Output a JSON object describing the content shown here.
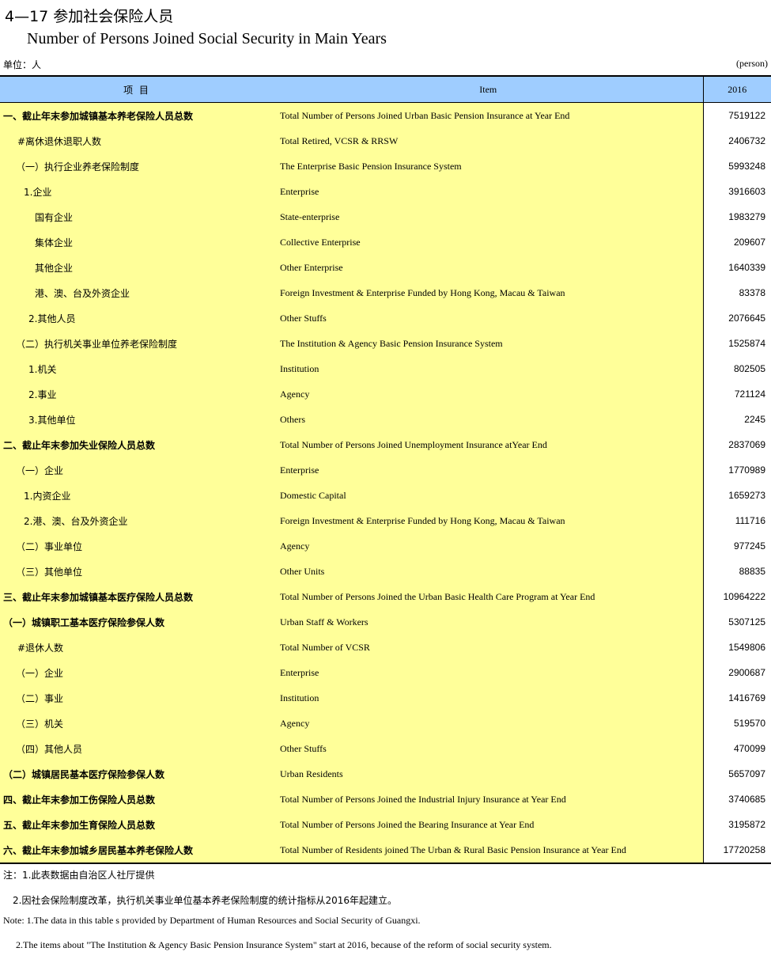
{
  "title": {
    "cn": "4—17  参加社会保险人员",
    "en": "Number of Persons Joined Social Security in Main Years"
  },
  "unit": {
    "cn": "单位：人",
    "en": "(person)"
  },
  "table": {
    "headers": {
      "item_cn": "项    目",
      "item_en": "Item",
      "year": "2016"
    },
    "rows": [
      {
        "cn": "一、截止年末参加城镇基本养老保险人员总数",
        "en": "Total Number of Persons Joined Urban Basic Pension Insurance at Year End",
        "value": "7519122",
        "bold": true,
        "indent": 0
      },
      {
        "cn": "#离休退休退职人数",
        "en": "Total Retired, VCSR & RRSW",
        "value": "2406732",
        "bold": false,
        "indent": 2
      },
      {
        "cn": "（一）执行企业养老保险制度",
        "en": "The Enterprise Basic Pension Insurance System",
        "value": "5993248",
        "bold": false,
        "indent": 1
      },
      {
        "cn": "1.企业",
        "en": "Enterprise",
        "value": "3916603",
        "bold": false,
        "indent": 3
      },
      {
        "cn": "国有企业",
        "en": "State-enterprise",
        "value": "1983279",
        "bold": false,
        "indent": 4
      },
      {
        "cn": "集体企业",
        "en": "Collective Enterprise",
        "value": "209607",
        "bold": false,
        "indent": 4
      },
      {
        "cn": "其他企业",
        "en": "Other Enterprise",
        "value": "1640339",
        "bold": false,
        "indent": 4
      },
      {
        "cn": "港、澳、台及外资企业",
        "en": "Foreign Investment & Enterprise Funded by Hong Kong, Macau & Taiwan",
        "value": "83378",
        "bold": false,
        "indent": 4
      },
      {
        "cn": "2.其他人员",
        "en": "Other Stuffs",
        "value": "2076645",
        "bold": false,
        "indent": 5
      },
      {
        "cn": "（二）执行机关事业单位养老保险制度",
        "en": "The Institution & Agency Basic Pension Insurance System",
        "value": "1525874",
        "bold": false,
        "indent": 1
      },
      {
        "cn": "1.机关",
        "en": "Institution",
        "value": "802505",
        "bold": false,
        "indent": 5
      },
      {
        "cn": "2.事业",
        "en": "Agency",
        "value": "721124",
        "bold": false,
        "indent": 5
      },
      {
        "cn": "3.其他单位",
        "en": "Others",
        "value": "2245",
        "bold": false,
        "indent": 5
      },
      {
        "cn": "二、截止年末参加失业保险人员总数",
        "en": "Total Number of Persons Joined Unemployment Insurance atYear End",
        "value": "2837069",
        "bold": true,
        "indent": 0
      },
      {
        "cn": "（一）企业",
        "en": "Enterprise",
        "value": "1770989",
        "bold": false,
        "indent": 1
      },
      {
        "cn": "1.内资企业",
        "en": "Domestic Capital",
        "value": "1659273",
        "bold": false,
        "indent": 3
      },
      {
        "cn": "2.港、澳、台及外资企业",
        "en": "Foreign Investment & Enterprise Funded by Hong Kong, Macau & Taiwan",
        "value": "111716",
        "bold": false,
        "indent": 3
      },
      {
        "cn": "（二）事业单位",
        "en": "Agency",
        "value": "977245",
        "bold": false,
        "indent": 1
      },
      {
        "cn": "（三）其他单位",
        "en": "Other Units",
        "value": "88835",
        "bold": false,
        "indent": 1
      },
      {
        "cn": "三、截止年末参加城镇基本医疗保险人员总数",
        "en": "Total Number of Persons Joined the Urban Basic Health Care Program at Year End",
        "value": "10964222",
        "bold": true,
        "indent": 0
      },
      {
        "cn": "（一）城镇职工基本医疗保险参保人数",
        "en": "Urban Staff & Workers",
        "value": "5307125",
        "bold": true,
        "indent": 0
      },
      {
        "cn": "#退休人数",
        "en": "Total Number of VCSR",
        "value": "1549806",
        "bold": false,
        "indent": 2
      },
      {
        "cn": "（一）企业",
        "en": "Enterprise",
        "value": "2900687",
        "bold": false,
        "indent": 1
      },
      {
        "cn": "（二）事业",
        "en": "Institution",
        "value": "1416769",
        "bold": false,
        "indent": 1
      },
      {
        "cn": "（三）机关",
        "en": "Agency",
        "value": "519570",
        "bold": false,
        "indent": 1
      },
      {
        "cn": "（四）其他人员",
        "en": "Other Stuffs",
        "value": "470099",
        "bold": false,
        "indent": 1
      },
      {
        "cn": "（二）城镇居民基本医疗保险参保人数",
        "en": " Urban Residents",
        "value": "5657097",
        "bold": true,
        "indent": 0
      },
      {
        "cn": "四、截止年末参加工伤保险人员总数",
        "en": "Total Number of Persons Joined the Industrial Injury Insurance at Year End",
        "value": "3740685",
        "bold": true,
        "indent": 0
      },
      {
        "cn": "五、截止年末参加生育保险人员总数",
        "en": "Total Number of Persons Joined the Bearing Insurance at Year End",
        "value": "3195872",
        "bold": true,
        "indent": 0
      },
      {
        "cn": "六、截止年末参加城乡居民基本养老保险人数",
        "en": "Total Number of Residents joined The Urban & Rural Basic Pension Insurance at Year End",
        "value": "17720258",
        "bold": true,
        "indent": 0
      }
    ]
  },
  "notes": {
    "cn1": "注：1.此表数据由自治区人社厅提供",
    "cn2": "2.因社会保险制度改革，执行机关事业单位基本养老保险制度的统计指标从2016年起建立。",
    "en1": "Note: 1.The data in this table s provided by Department of Human Resources and Social Security of Guangxi.",
    "en2": "2.The items about \"The Institution & Agency Basic Pension Insurance System\" start at 2016, because of the reform of social security system."
  }
}
